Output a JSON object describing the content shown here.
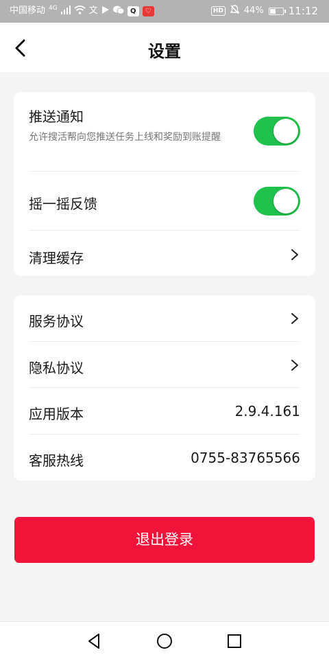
{
  "status_bar": {
    "carrier": "中国移动",
    "network": "4G",
    "battery": "44%",
    "time": "11:12",
    "hd": "HD",
    "icons": [
      "signal-icon",
      "wifi-icon",
      "translate-icon",
      "location-icon",
      "wechat-icon",
      "qq-icon",
      "app-notification-icon",
      "mute-icon",
      "battery-icon"
    ]
  },
  "header": {
    "title": "设置",
    "back_icon": "chevron-left-icon"
  },
  "settings_group_1": {
    "push": {
      "title": "推送通知",
      "description": "允许搜活帮向您推送任务上线和奖励到账提醒",
      "enabled": true
    },
    "shake": {
      "title": "摇一摇反馈",
      "enabled": true
    },
    "cache": {
      "title": "清理缓存"
    }
  },
  "settings_group_2": {
    "service_agreement": {
      "title": "服务协议"
    },
    "privacy_agreement": {
      "title": "隐私协议"
    },
    "app_version": {
      "title": "应用版本",
      "value": "2.9.4.161"
    },
    "hotline": {
      "title": "客服热线",
      "value": "0755-83765566"
    }
  },
  "logout": {
    "label": "退出登录"
  },
  "colors": {
    "accent_red": "#f0133a",
    "toggle_green": "#21c14e",
    "status_bar_bg": "#b3b3b3"
  },
  "nav_bar": {
    "icons": [
      "back-triangle-icon",
      "home-circle-icon",
      "recents-square-icon"
    ]
  }
}
